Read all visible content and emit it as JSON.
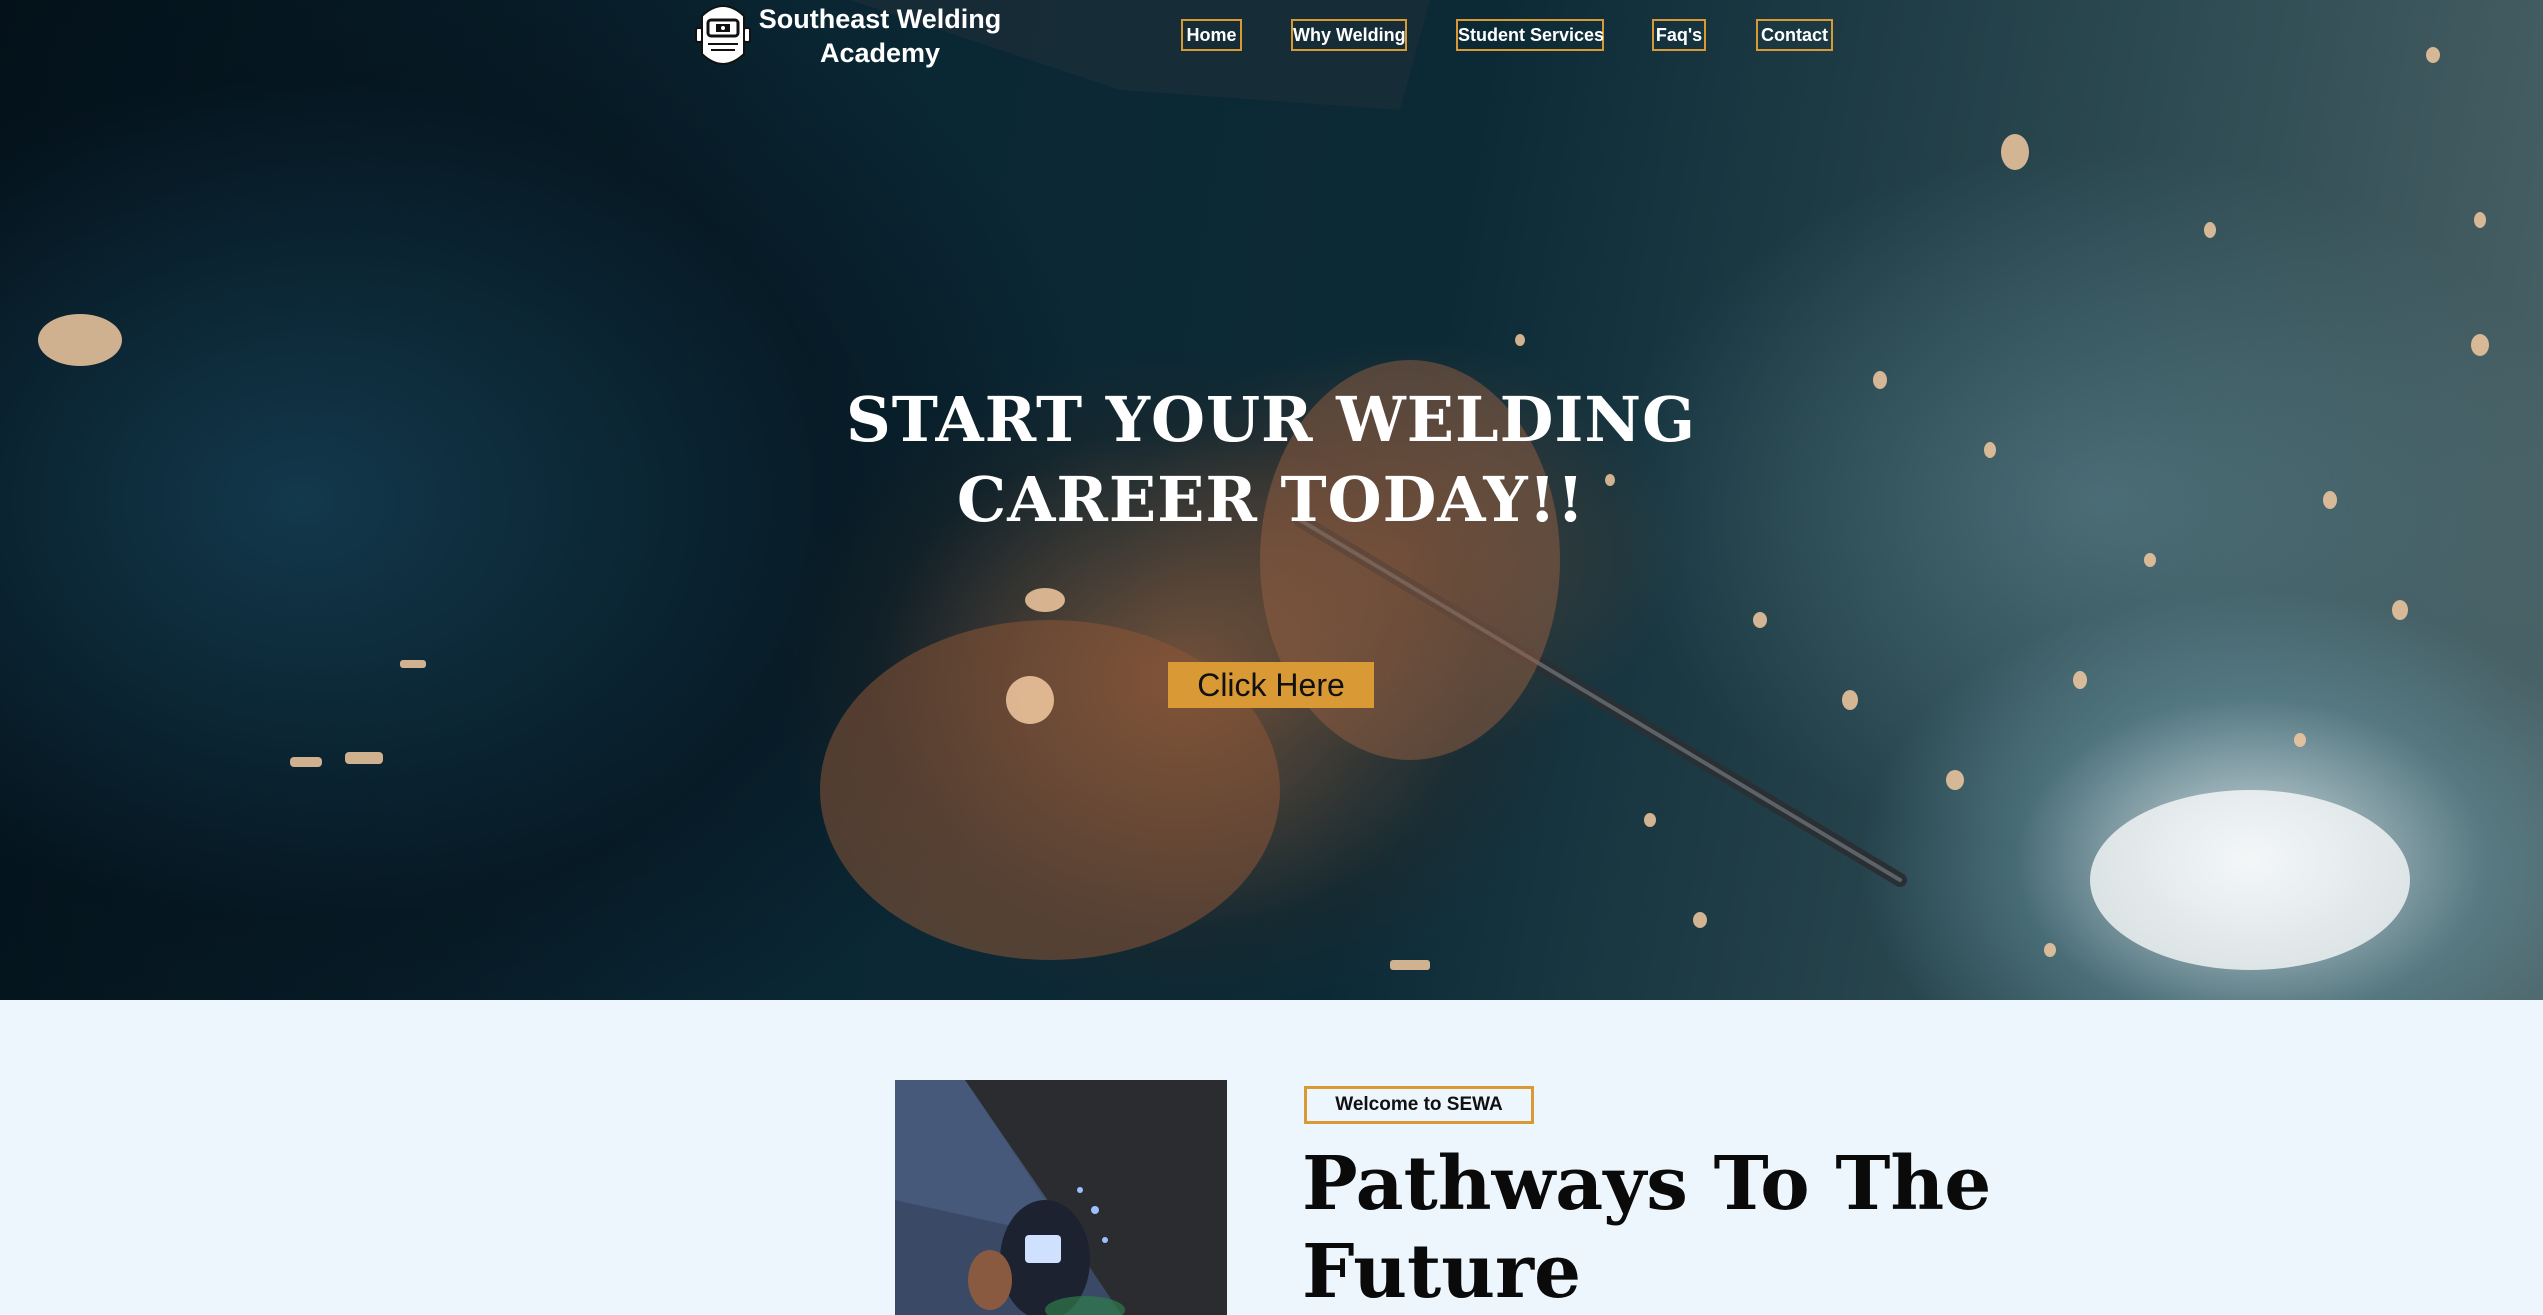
{
  "header": {
    "site_name": "Southeast Welding Academy",
    "logo_icon": "welding-helmet-icon"
  },
  "nav": {
    "items": [
      {
        "label": "Home"
      },
      {
        "label": "Why Welding"
      },
      {
        "label": "Student Services"
      },
      {
        "label": "Faq's"
      },
      {
        "label": "Contact"
      }
    ]
  },
  "hero": {
    "title": "START YOUR WELDING CAREER TODAY!!",
    "cta_label": "Click Here"
  },
  "about": {
    "badge": "Welcome to SEWA",
    "heading": "Pathways To The Future"
  },
  "colors": {
    "accent": "#d99a35",
    "section_bg": "#eef6fd",
    "hero_dark": "#0a2633"
  }
}
